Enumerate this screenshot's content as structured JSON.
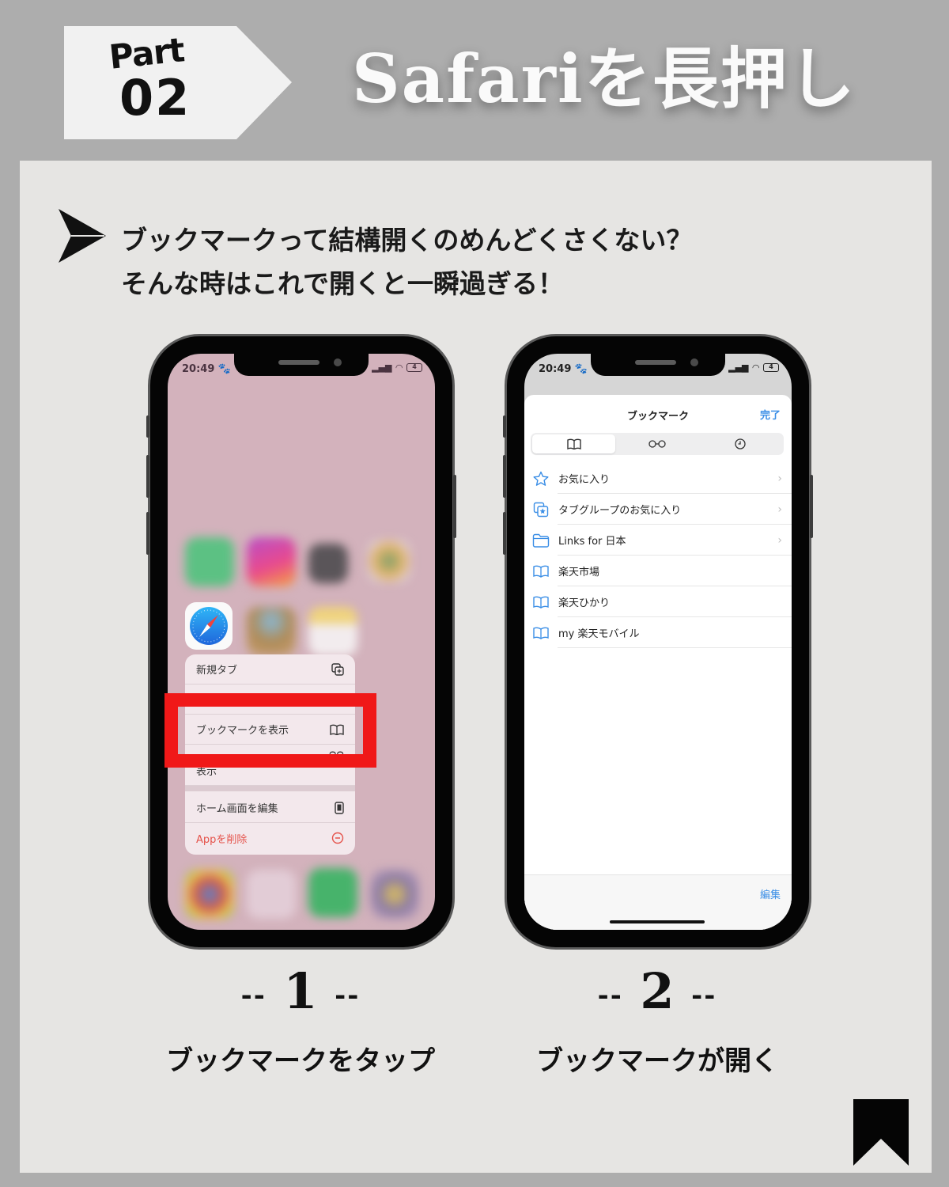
{
  "header": {
    "part_label": "Part",
    "part_number": "02",
    "title": "Safariを長押し"
  },
  "intro": {
    "line1": "ブックマークって結構開くのめんどくさくない？",
    "line2": "そんな時はこれで開くと一瞬過ぎる！"
  },
  "phone1": {
    "status_time": "20:49",
    "battery": "4",
    "app_icon": "safari-icon",
    "context_menu": [
      {
        "label": "新規タブ",
        "icon": "new-tab-icon"
      },
      {
        "label": "ブックマークを表示",
        "icon": "book-icon",
        "highlighted": true
      },
      {
        "label": "表示",
        "icon": "glasses-icon"
      },
      {
        "label": "ホーム画面を編集",
        "icon": "phone-icon"
      },
      {
        "label": "Appを削除",
        "icon": "minus-circle-icon",
        "destructive": true
      }
    ]
  },
  "phone2": {
    "status_time": "20:49",
    "battery": "4",
    "sheet_title": "ブックマーク",
    "done_label": "完了",
    "segments": [
      {
        "icon": "book-icon",
        "glyph": "📖",
        "active": true
      },
      {
        "icon": "glasses-icon",
        "glyph": "ᴑᴑ"
      },
      {
        "icon": "clock-icon",
        "glyph": "◷"
      }
    ],
    "bookmarks": [
      {
        "label": "お気に入り",
        "icon": "star-icon",
        "has_chevron": true
      },
      {
        "label": "タブグループのお気に入り",
        "icon": "tab-group-star-icon",
        "has_chevron": true
      },
      {
        "label": "Links for 日本",
        "icon": "folder-icon",
        "has_chevron": true
      },
      {
        "label": "楽天市場",
        "icon": "book-icon",
        "has_chevron": false
      },
      {
        "label": "楽天ひかり",
        "icon": "book-icon",
        "has_chevron": false
      },
      {
        "label": "my 楽天モバイル",
        "icon": "book-icon",
        "has_chevron": false
      }
    ],
    "edit_label": "編集"
  },
  "steps": [
    {
      "dash": "--",
      "number": "1",
      "caption": "ブックマークをタップ"
    },
    {
      "dash": "--",
      "number": "2",
      "caption": "ブックマークが開く"
    }
  ],
  "colors": {
    "highlight": "#f01818",
    "ios_blue": "#3a8ee6",
    "destructive": "#e5534b",
    "wallpaper": "#d3b2bc"
  }
}
